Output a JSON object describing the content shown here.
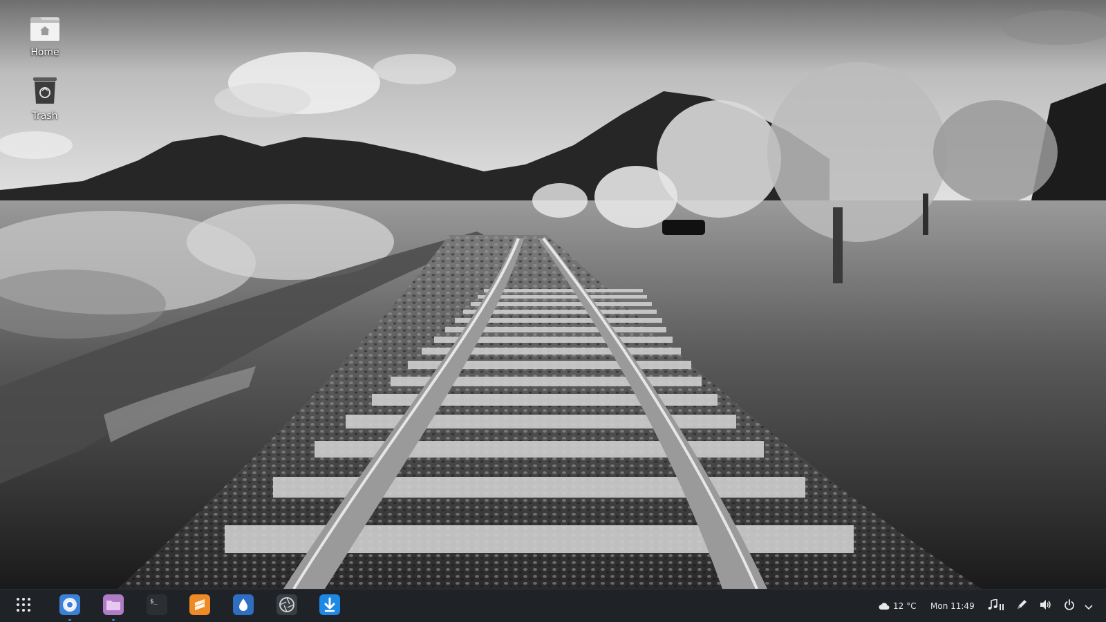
{
  "desktop": {
    "icons": [
      {
        "label": "Home",
        "icon": "folder-home-icon"
      },
      {
        "label": "Trash",
        "icon": "trash-icon"
      }
    ],
    "wallpaper": "black-and-white railroad tracks landscape"
  },
  "taskbar": {
    "apps": [
      {
        "name": "app-launcher",
        "icon": "grid-icon"
      },
      {
        "name": "chromium",
        "icon": "chromium-icon",
        "running": true
      },
      {
        "name": "files",
        "icon": "folder-icon",
        "running": true
      },
      {
        "name": "terminal",
        "icon": "terminal-icon"
      },
      {
        "name": "sublime",
        "icon": "sublime-icon"
      },
      {
        "name": "drop",
        "icon": "drop-icon"
      },
      {
        "name": "aperture",
        "icon": "aperture-icon"
      },
      {
        "name": "download",
        "icon": "download-icon"
      }
    ],
    "tray": {
      "weather_icon": "cloud-icon",
      "weather_text": "12 °C",
      "clock": "Mon 11:49",
      "music_icon": "music-note-icon",
      "pause_icon": "pause-icon",
      "pen_icon": "pen-icon",
      "volume_icon": "speaker-icon",
      "power_icon": "power-icon",
      "menu_icon": "chevron-down-icon"
    }
  },
  "colors": {
    "taskbar_bg": "#1f2328",
    "accent": "#4a90d9",
    "chromium_blue": "#3b82d6",
    "files_purple": "#b07cc6",
    "sublime_orange": "#f08a24",
    "drop_blue": "#2f6fc2",
    "download_blue": "#1e88e5"
  }
}
